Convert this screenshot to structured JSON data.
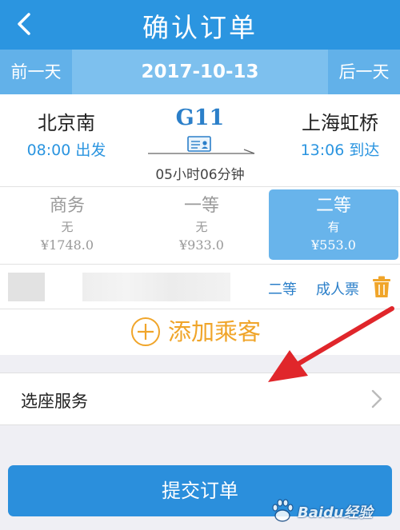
{
  "header": {
    "title": "确认订单"
  },
  "date_bar": {
    "prev_label": "前一天",
    "current_date": "2017-10-13",
    "next_label": "后一天"
  },
  "train": {
    "number": "G11",
    "departure": {
      "station": "北京南",
      "time_label": "08:00 出发"
    },
    "arrival": {
      "station": "上海虹桥",
      "time_label": "13:06 到达"
    },
    "duration": "05小时06分钟"
  },
  "seats": [
    {
      "name": "商务",
      "availability": "无",
      "price": "¥1748.0",
      "selected": false
    },
    {
      "name": "一等",
      "availability": "无",
      "price": "¥933.0",
      "selected": false
    },
    {
      "name": "二等",
      "availability": "有",
      "price": "¥553.0",
      "selected": true
    }
  ],
  "passenger": {
    "seat_class": "二等",
    "ticket_type": "成人票"
  },
  "add_passenger": {
    "label": "添加乘客"
  },
  "seat_service": {
    "label": "选座服务"
  },
  "submit": {
    "label": "提交订单"
  },
  "watermark": {
    "text": "Baidu经验"
  },
  "colors": {
    "primary": "#2b95e0",
    "accent_orange": "#f0a52a",
    "arrow_red": "#e0262b"
  },
  "icons": [
    "back-arrow-icon",
    "ticket-icon",
    "trash-icon",
    "plus-circle-icon",
    "chevron-right-icon",
    "baidu-paw-icon"
  ]
}
